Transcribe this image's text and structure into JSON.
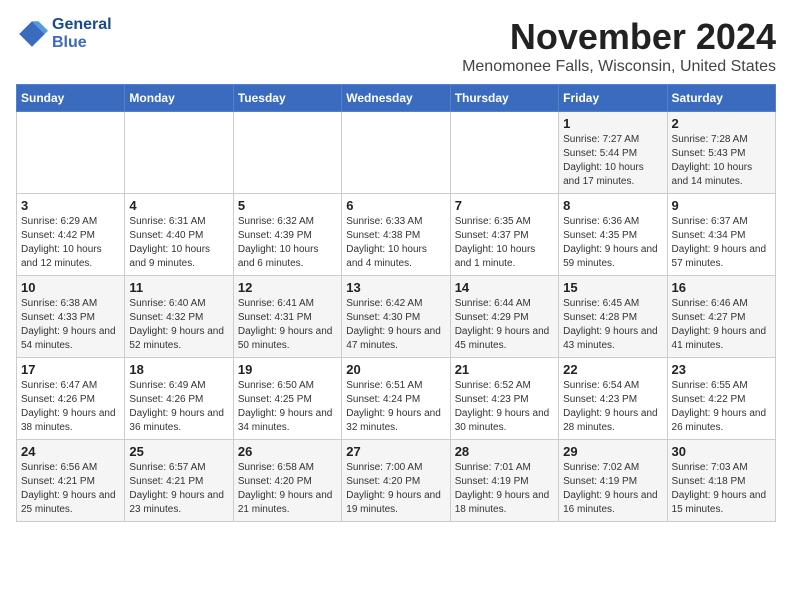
{
  "logo": {
    "line1": "General",
    "line2": "Blue"
  },
  "header": {
    "month": "November 2024",
    "location": "Menomonee Falls, Wisconsin, United States"
  },
  "weekdays": [
    "Sunday",
    "Monday",
    "Tuesday",
    "Wednesday",
    "Thursday",
    "Friday",
    "Saturday"
  ],
  "weeks": [
    [
      {
        "day": "",
        "info": ""
      },
      {
        "day": "",
        "info": ""
      },
      {
        "day": "",
        "info": ""
      },
      {
        "day": "",
        "info": ""
      },
      {
        "day": "",
        "info": ""
      },
      {
        "day": "1",
        "info": "Sunrise: 7:27 AM\nSunset: 5:44 PM\nDaylight: 10 hours and 17 minutes."
      },
      {
        "day": "2",
        "info": "Sunrise: 7:28 AM\nSunset: 5:43 PM\nDaylight: 10 hours and 14 minutes."
      }
    ],
    [
      {
        "day": "3",
        "info": "Sunrise: 6:29 AM\nSunset: 4:42 PM\nDaylight: 10 hours and 12 minutes."
      },
      {
        "day": "4",
        "info": "Sunrise: 6:31 AM\nSunset: 4:40 PM\nDaylight: 10 hours and 9 minutes."
      },
      {
        "day": "5",
        "info": "Sunrise: 6:32 AM\nSunset: 4:39 PM\nDaylight: 10 hours and 6 minutes."
      },
      {
        "day": "6",
        "info": "Sunrise: 6:33 AM\nSunset: 4:38 PM\nDaylight: 10 hours and 4 minutes."
      },
      {
        "day": "7",
        "info": "Sunrise: 6:35 AM\nSunset: 4:37 PM\nDaylight: 10 hours and 1 minute."
      },
      {
        "day": "8",
        "info": "Sunrise: 6:36 AM\nSunset: 4:35 PM\nDaylight: 9 hours and 59 minutes."
      },
      {
        "day": "9",
        "info": "Sunrise: 6:37 AM\nSunset: 4:34 PM\nDaylight: 9 hours and 57 minutes."
      }
    ],
    [
      {
        "day": "10",
        "info": "Sunrise: 6:38 AM\nSunset: 4:33 PM\nDaylight: 9 hours and 54 minutes."
      },
      {
        "day": "11",
        "info": "Sunrise: 6:40 AM\nSunset: 4:32 PM\nDaylight: 9 hours and 52 minutes."
      },
      {
        "day": "12",
        "info": "Sunrise: 6:41 AM\nSunset: 4:31 PM\nDaylight: 9 hours and 50 minutes."
      },
      {
        "day": "13",
        "info": "Sunrise: 6:42 AM\nSunset: 4:30 PM\nDaylight: 9 hours and 47 minutes."
      },
      {
        "day": "14",
        "info": "Sunrise: 6:44 AM\nSunset: 4:29 PM\nDaylight: 9 hours and 45 minutes."
      },
      {
        "day": "15",
        "info": "Sunrise: 6:45 AM\nSunset: 4:28 PM\nDaylight: 9 hours and 43 minutes."
      },
      {
        "day": "16",
        "info": "Sunrise: 6:46 AM\nSunset: 4:27 PM\nDaylight: 9 hours and 41 minutes."
      }
    ],
    [
      {
        "day": "17",
        "info": "Sunrise: 6:47 AM\nSunset: 4:26 PM\nDaylight: 9 hours and 38 minutes."
      },
      {
        "day": "18",
        "info": "Sunrise: 6:49 AM\nSunset: 4:26 PM\nDaylight: 9 hours and 36 minutes."
      },
      {
        "day": "19",
        "info": "Sunrise: 6:50 AM\nSunset: 4:25 PM\nDaylight: 9 hours and 34 minutes."
      },
      {
        "day": "20",
        "info": "Sunrise: 6:51 AM\nSunset: 4:24 PM\nDaylight: 9 hours and 32 minutes."
      },
      {
        "day": "21",
        "info": "Sunrise: 6:52 AM\nSunset: 4:23 PM\nDaylight: 9 hours and 30 minutes."
      },
      {
        "day": "22",
        "info": "Sunrise: 6:54 AM\nSunset: 4:23 PM\nDaylight: 9 hours and 28 minutes."
      },
      {
        "day": "23",
        "info": "Sunrise: 6:55 AM\nSunset: 4:22 PM\nDaylight: 9 hours and 26 minutes."
      }
    ],
    [
      {
        "day": "24",
        "info": "Sunrise: 6:56 AM\nSunset: 4:21 PM\nDaylight: 9 hours and 25 minutes."
      },
      {
        "day": "25",
        "info": "Sunrise: 6:57 AM\nSunset: 4:21 PM\nDaylight: 9 hours and 23 minutes."
      },
      {
        "day": "26",
        "info": "Sunrise: 6:58 AM\nSunset: 4:20 PM\nDaylight: 9 hours and 21 minutes."
      },
      {
        "day": "27",
        "info": "Sunrise: 7:00 AM\nSunset: 4:20 PM\nDaylight: 9 hours and 19 minutes."
      },
      {
        "day": "28",
        "info": "Sunrise: 7:01 AM\nSunset: 4:19 PM\nDaylight: 9 hours and 18 minutes."
      },
      {
        "day": "29",
        "info": "Sunrise: 7:02 AM\nSunset: 4:19 PM\nDaylight: 9 hours and 16 minutes."
      },
      {
        "day": "30",
        "info": "Sunrise: 7:03 AM\nSunset: 4:18 PM\nDaylight: 9 hours and 15 minutes."
      }
    ]
  ]
}
